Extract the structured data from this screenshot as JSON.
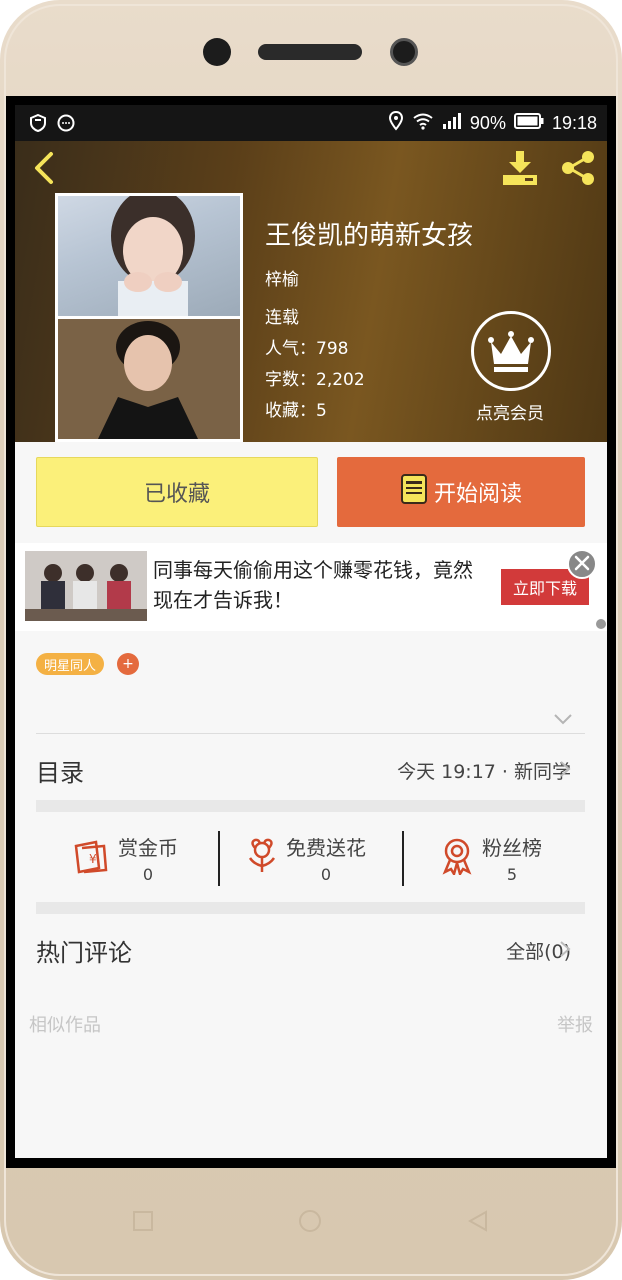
{
  "statusbar": {
    "battery": "90%",
    "time": "19:18"
  },
  "book": {
    "title": "王俊凯的萌新女孩",
    "author": "梓榆",
    "status": "连载",
    "popularity_label": "人气",
    "popularity": "798",
    "word_count_label": "字数",
    "word_count": "2,202",
    "favorites_label": "收藏",
    "favorites": "5"
  },
  "vip": {
    "label": "点亮会员"
  },
  "actions": {
    "collected_label": "已收藏",
    "read_label": "开始阅读"
  },
  "ad": {
    "text": "同事每天偷偷用这个赚零花钱，竟然现在才告诉我！",
    "button_label": "立即下载"
  },
  "tags": [
    "明星同人"
  ],
  "tag_add_label": "+",
  "toc": {
    "title": "目录",
    "latest": "今天 19:17 · 新同学"
  },
  "stats": [
    {
      "label": "赏金币",
      "value": "0",
      "icon": "reward-coin-icon"
    },
    {
      "label": "免费送花",
      "value": "0",
      "icon": "flower-icon"
    },
    {
      "label": "粉丝榜",
      "value": "5",
      "icon": "medal-icon"
    }
  ],
  "comments": {
    "title": "热门评论",
    "all_label": "全部(0)"
  },
  "footer": {
    "similar_label": "相似作品",
    "report_label": "举报"
  },
  "colors": {
    "accent_orange": "#e46a3d",
    "collected_yellow": "#fbf07a",
    "icon_yellow": "#f5e45a",
    "ad_red": "#d23a3a"
  }
}
